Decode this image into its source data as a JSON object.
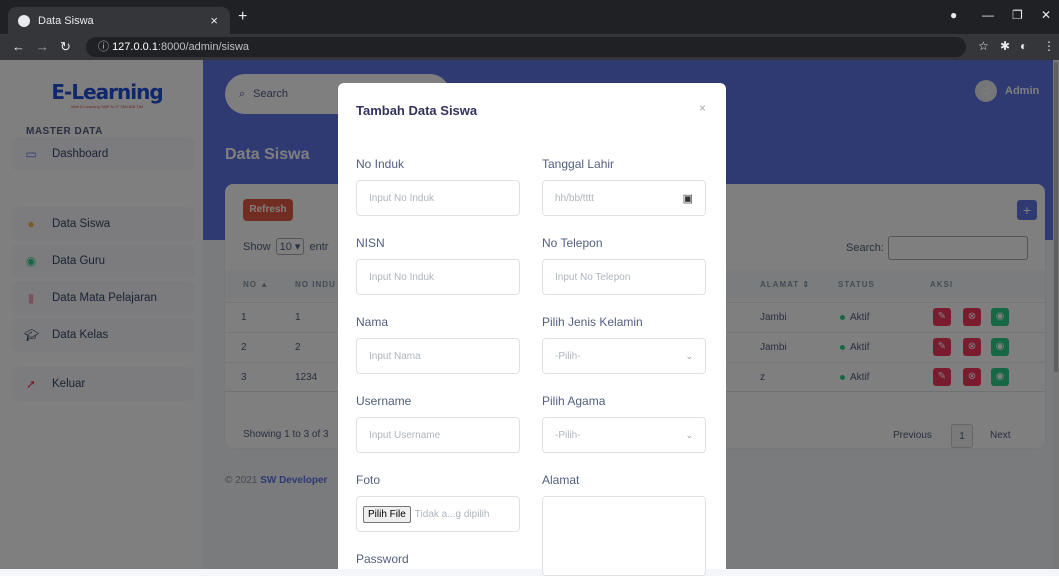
{
  "browser": {
    "tab_title": "Data Siswa",
    "url_host": "127.0.0.1",
    "url_rest": ":8000/admin/siswa"
  },
  "sidebar": {
    "logo_title": "E-Learning",
    "logo_subtitle": "Web E-Learning SMP N 27 TANJAB TIM",
    "dashboard": "Dashboard",
    "section": "MASTER DATA",
    "items": [
      "Data Siswa",
      "Data Guru",
      "Data Mata Pelajaran",
      "Data Kelas"
    ],
    "logout": "Keluar"
  },
  "header": {
    "search_placeholder": "Search",
    "user": "Admin",
    "page_title": "Data Siswa"
  },
  "table": {
    "refresh": "Refresh",
    "add": "+",
    "show_label": "Show",
    "show_value": "10",
    "entries_label": "entr",
    "search_label": "Search:",
    "headers": [
      "NO",
      "NO INDU",
      "ALAMAT",
      "STATUS",
      "AKSI"
    ],
    "rows": [
      {
        "no": "1",
        "induk": "1",
        "alamat": "Jambi",
        "status": "Aktif"
      },
      {
        "no": "2",
        "induk": "2",
        "alamat": "Jambi",
        "status": "Aktif"
      },
      {
        "no": "3",
        "induk": "1234",
        "alamat": "z",
        "status": "Aktif"
      }
    ],
    "showing": "Showing 1 to 3 of 3",
    "prev": "Previous",
    "page": "1",
    "next": "Next"
  },
  "footer": {
    "copy": "© 2021",
    "brand": "SW Developer"
  },
  "modal": {
    "title": "Tambah Data Siswa",
    "close": "×",
    "no_induk_label": "No Induk",
    "no_induk_ph": "Input No Induk",
    "tgl_label": "Tanggal Lahir",
    "tgl_ph": "hh/bb/tttt",
    "nisn_label": "NISN",
    "nisn_ph": "Input No Induk",
    "telp_label": "No Telepon",
    "telp_ph": "Input No Telepon",
    "nama_label": "Nama",
    "nama_ph": "Input Nama",
    "jk_label": "Pilih Jenis Kelamin",
    "jk_value": "-Pilih-",
    "username_label": "Username",
    "username_ph": "Input Username",
    "agama_label": "Pilih Agama",
    "agama_value": "-Pilih-",
    "foto_label": "Foto",
    "file_button": "Pilih File",
    "file_status": "Tidak a...g dipilih",
    "alamat_label": "Alamat",
    "password_label": "Password"
  },
  "colors": {
    "primary": "#5e72e4",
    "danger": "#e25b45",
    "success": "#2dce89"
  }
}
